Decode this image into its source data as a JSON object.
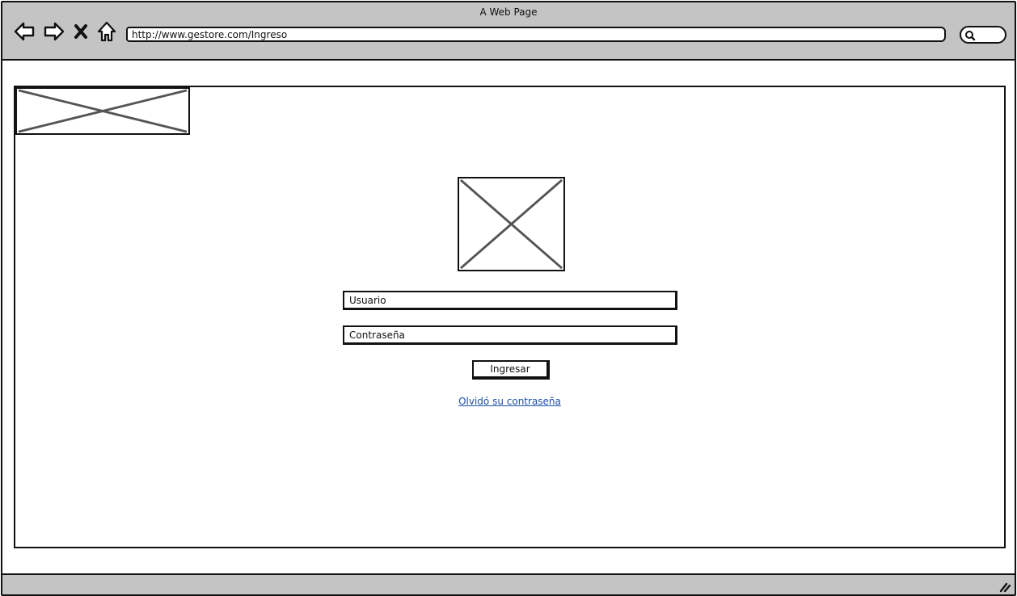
{
  "window": {
    "title": "A Web Page"
  },
  "toolbar": {
    "back_icon": "back-arrow-icon",
    "forward_icon": "forward-arrow-icon",
    "stop_icon": "close-icon",
    "home_icon": "home-icon",
    "url": "http://www.gestore.com/Ingreso",
    "search_icon": "search-icon"
  },
  "login": {
    "username_placeholder": "Usuario",
    "password_placeholder": "Contraseña",
    "submit_label": "Ingresar",
    "forgot_link": "Olvidó su contraseña"
  },
  "colors": {
    "chrome": "#c4c4c4",
    "link": "#1a4ea8"
  }
}
